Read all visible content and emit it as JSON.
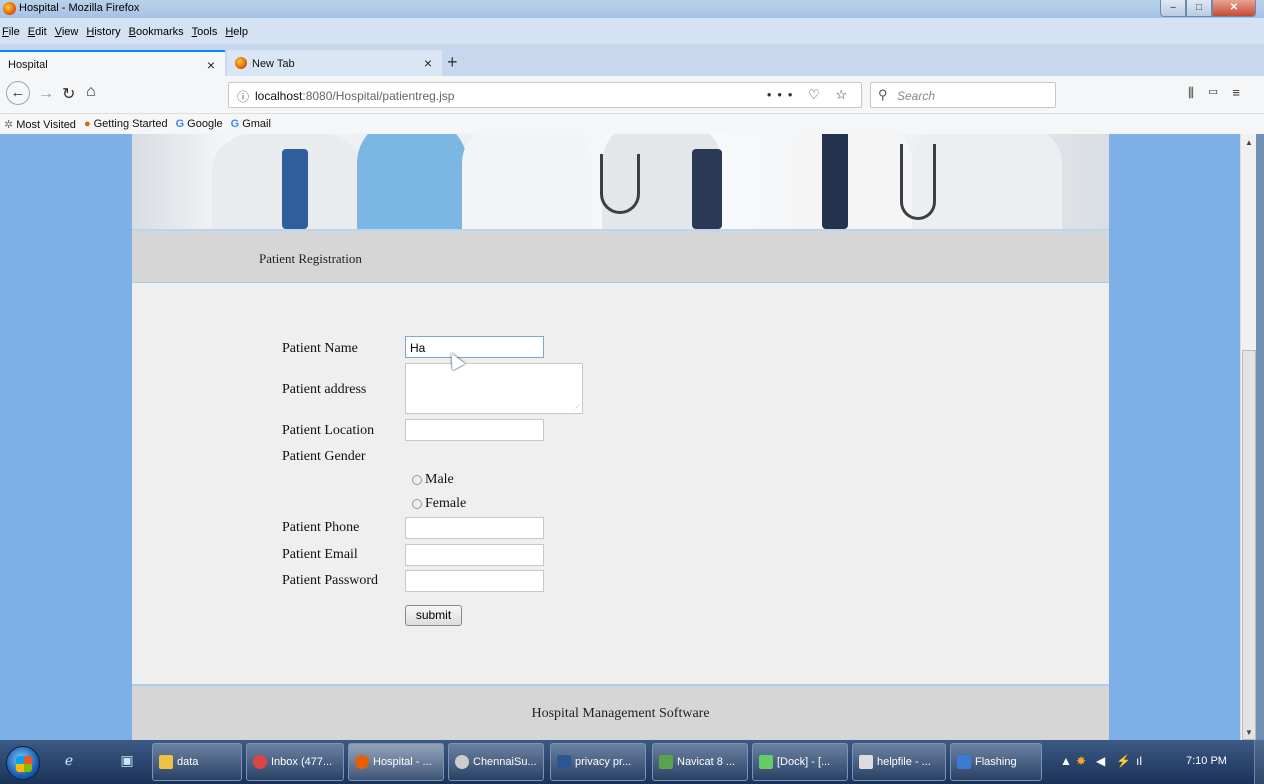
{
  "window": {
    "title": "Hospital - Mozilla Firefox"
  },
  "menu": [
    "File",
    "Edit",
    "View",
    "History",
    "Bookmarks",
    "Tools",
    "Help"
  ],
  "tabs": [
    {
      "label": "Hospital",
      "close": "×"
    },
    {
      "label": "New Tab",
      "close": "×"
    }
  ],
  "nav": {
    "url_host": "localhost",
    "url_path": ":8080/Hospital/patientreg.jsp",
    "url_actions": "••• ♡ ☆",
    "search_placeholder": "Search"
  },
  "bookmarks": [
    "Most Visited",
    "Getting Started",
    "Google",
    "Gmail"
  ],
  "page": {
    "header_title": "Patient Registration",
    "footer_text": "Hospital Management Software",
    "form": {
      "name_label": "Patient Name",
      "name_value": "Ha",
      "address_label": "Patient address",
      "location_label": "Patient Location",
      "gender_label": "Patient Gender",
      "gender_options": [
        "Male",
        "Female"
      ],
      "phone_label": "Patient Phone",
      "email_label": "Patient Email",
      "password_label": "Patient Password",
      "submit_label": "submit"
    }
  },
  "taskbar": {
    "tasks": [
      "data",
      "Inbox (477...",
      "Hospital - ...",
      "ChennaiSu...",
      "privacy pr...",
      "Navicat 8 ...",
      "[Dock] - [...",
      "helpfile - ...",
      "Flashing"
    ],
    "clock": "7:10 PM"
  },
  "colors": {
    "accent": "#0a84ff",
    "page_bg": "#7eb0e8",
    "panel_bg": "#efefef",
    "header_bg": "#d6d6d6"
  }
}
